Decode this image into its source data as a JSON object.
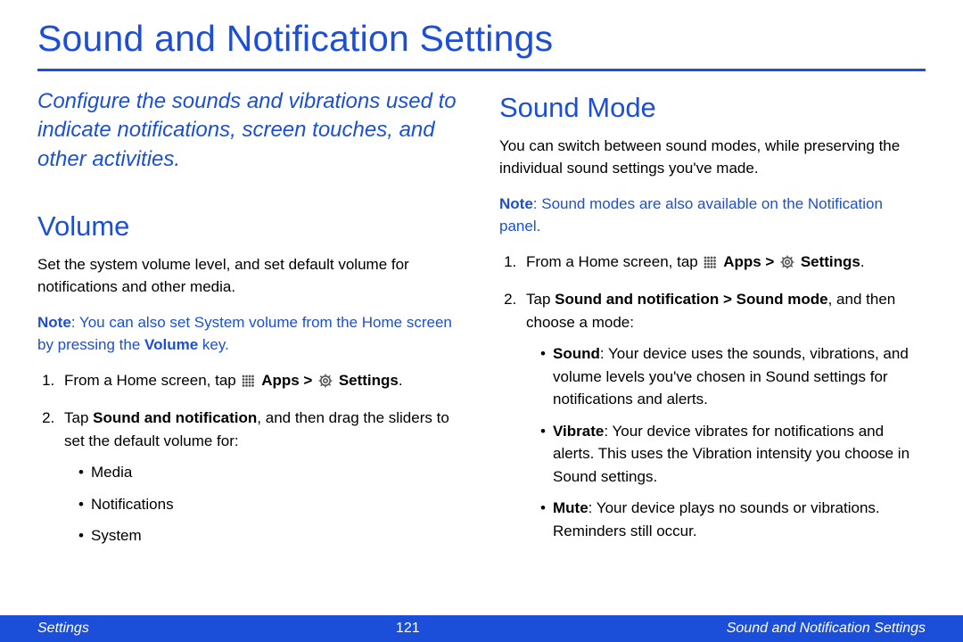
{
  "pageTitle": "Sound and Notification Settings",
  "intro": "Configure the sounds and vibrations used to indicate notifications, screen touches, and other activities.",
  "left": {
    "heading": "Volume",
    "desc": "Set the system volume level, and set default volume for notifications and other media.",
    "noteLabel": "Note",
    "notePre": ": You can also set System volume from the Home screen by pressing the ",
    "noteBold": "Volume",
    "notePost": " key.",
    "step1Pre": "From a Home screen, tap ",
    "step1Apps": "Apps > ",
    "step1Settings": "Settings",
    "step1Post": ".",
    "step2Pre": "Tap ",
    "step2Bold": "Sound and notification",
    "step2Post": ", and then drag the sliders to set the default volume for:",
    "bullets": {
      "b1": "Media",
      "b2": "Notifications",
      "b3": "System"
    }
  },
  "right": {
    "heading": "Sound Mode",
    "desc": "You can switch between sound modes, while preserving the individual sound settings you've made.",
    "noteLabel": "Note",
    "noteText": ": Sound modes are also available on the Notification panel.",
    "step1Pre": "From a Home screen, tap ",
    "step1Apps": "Apps > ",
    "step1Settings": "Settings",
    "step1Post": ".",
    "step2Pre": "Tap ",
    "step2Bold": "Sound and notification > Sound mode",
    "step2Post": ", and then choose a mode:",
    "modes": {
      "soundLabel": "Sound",
      "soundText": ": Your device uses the sounds, vibrations, and volume levels you've chosen in Sound settings for notifications and alerts.",
      "vibrateLabel": "Vibrate",
      "vibrateText": ": Your device vibrates for notifications and alerts. This uses the Vibration intensity you choose in Sound settings.",
      "muteLabel": "Mute",
      "muteText": ": Your device plays no sounds or vibrations. Reminders still occur."
    }
  },
  "footer": {
    "left": "Settings",
    "page": "121",
    "right": "Sound and Notification Settings"
  }
}
